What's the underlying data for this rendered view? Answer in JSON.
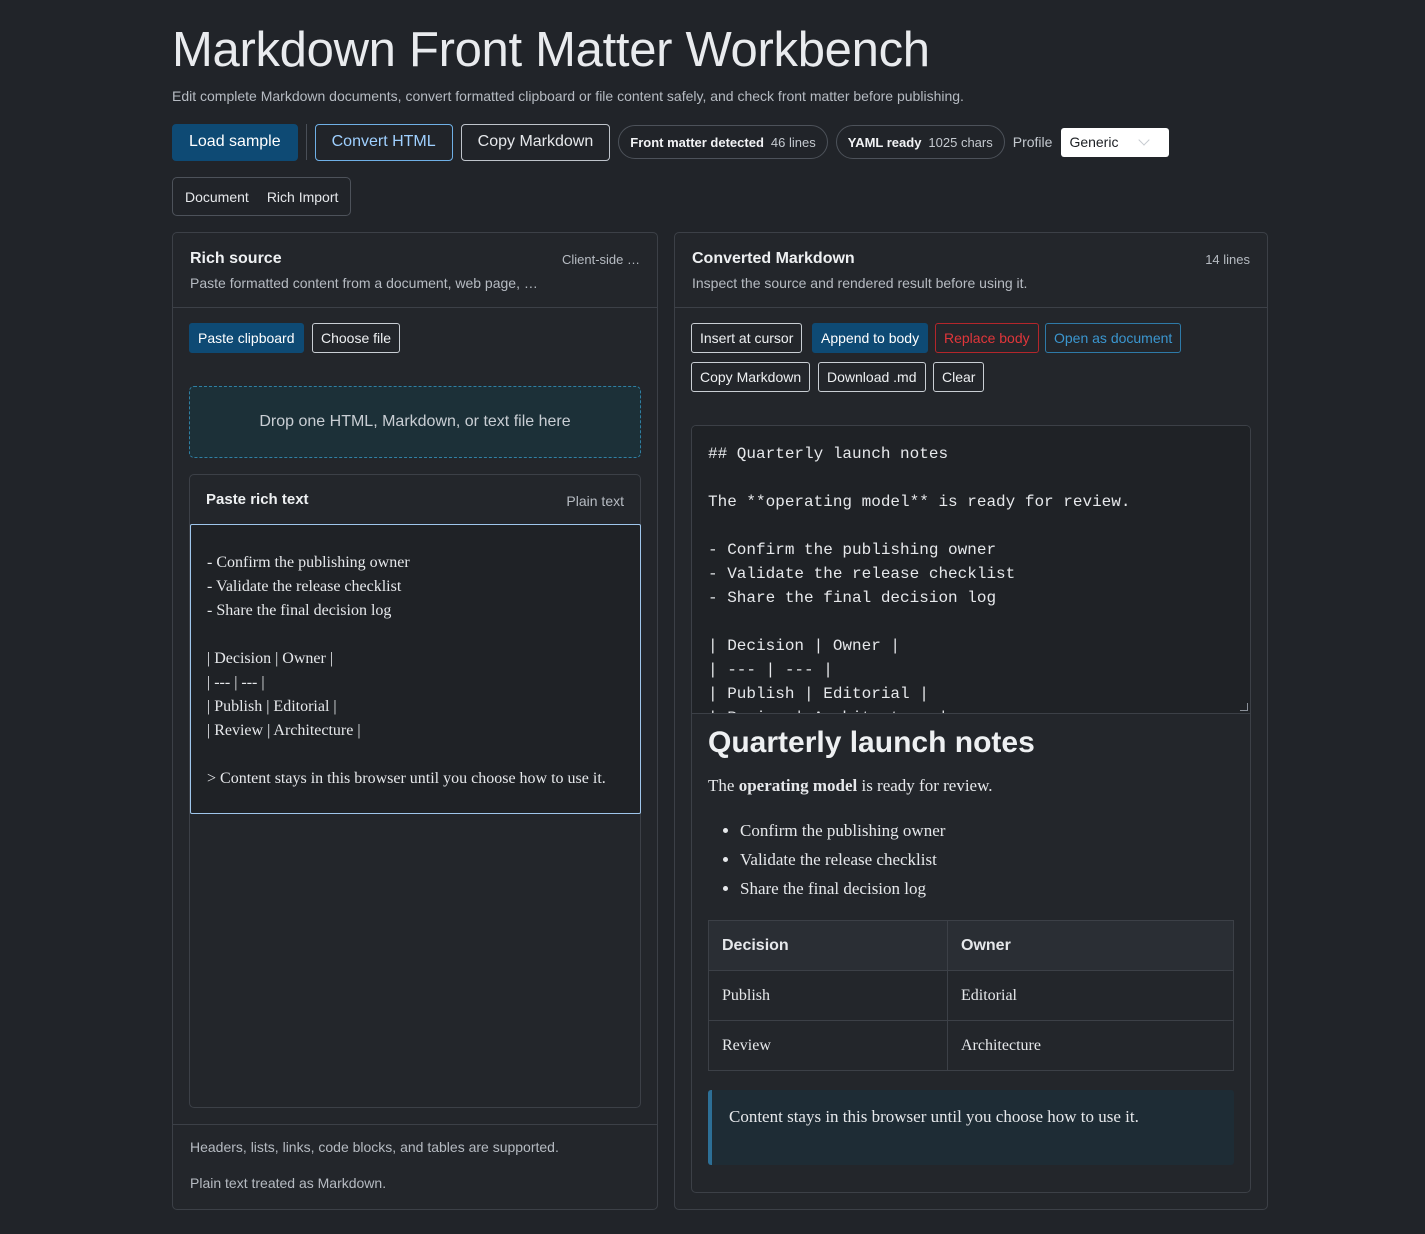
{
  "header": {
    "title": "Markdown Front Matter Workbench",
    "subtitle": "Edit complete Markdown documents, convert formatted clipboard or file content safely, and check front matter before publishing."
  },
  "toolbar": {
    "load_sample": "Load sample",
    "convert_html": "Convert HTML",
    "copy_markdown": "Copy Markdown",
    "front_matter_label": "Front matter detected",
    "front_matter_value": "46 lines",
    "yaml_label": "YAML ready",
    "yaml_value": "1025 chars",
    "profile_label": "Profile",
    "profile_value": "Generic"
  },
  "tabs": [
    "Document",
    "Rich Import"
  ],
  "rich_source": {
    "title": "Rich source",
    "subtitle": "Paste formatted content from a document, web page, …",
    "badge": "Client-side …",
    "paste_clipboard": "Paste clipboard",
    "choose_file": "Choose file",
    "dropzone": "Drop one HTML, Markdown, or text file here",
    "paste_title": "Paste rich text",
    "paste_mode": "Plain text",
    "paste_lines": [
      "- Confirm the publishing owner",
      "- Validate the release checklist",
      "- Share the final decision log",
      "",
      "| Decision | Owner |",
      "| --- | --- |",
      "| Publish | Editorial |",
      "| Review | Architecture |",
      ""
    ],
    "paste_wrapped": "> Content stays in this browser until you choose how to use it.",
    "footer_support": "Headers, lists, links, code blocks, and tables are supported.",
    "footer_mode": "Plain text treated as Markdown."
  },
  "converted": {
    "title": "Converted Markdown",
    "subtitle": "Inspect the source and rendered result before using it.",
    "line_count": "14 lines",
    "actions": {
      "insert": "Insert at cursor",
      "append": "Append to body",
      "replace": "Replace body",
      "open": "Open as document",
      "copy": "Copy Markdown",
      "download": "Download .md",
      "clear": "Clear"
    },
    "source_lines": [
      "## Quarterly launch notes",
      "",
      "The **operating model** is ready for review.",
      "",
      "- Confirm the publishing owner",
      "- Validate the release checklist",
      "- Share the final decision log",
      "",
      "| Decision | Owner |",
      "| --- | --- |",
      "| Publish | Editorial |",
      "| Review | Architecture |"
    ],
    "preview": {
      "heading": "Quarterly launch notes",
      "para_before": "The ",
      "para_bold": "operating model",
      "para_after": " is ready for review.",
      "list": [
        "Confirm the publishing owner",
        "Validate the release checklist",
        "Share the final decision log"
      ],
      "table_headers": [
        "Decision",
        "Owner"
      ],
      "table_rows": [
        [
          "Publish",
          "Editorial"
        ],
        [
          "Review",
          "Architecture"
        ]
      ],
      "quote": "Content stays in this browser until you choose how to use it."
    }
  }
}
